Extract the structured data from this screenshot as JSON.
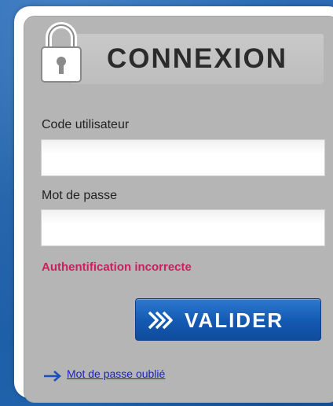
{
  "login": {
    "title": "CONNEXION",
    "username_label": "Code utilisateur",
    "username_value": "",
    "password_label": "Mot de passe",
    "password_value": "",
    "error_message": "Authentification incorrecte",
    "submit_label": "VALIDER",
    "forgot_password_label": "Mot de passe oublié"
  },
  "icons": {
    "lock": "lock-icon",
    "submit_chevrons": "double-chevron-right-icon",
    "forgot_arrow": "arrow-right-icon"
  },
  "colors": {
    "background": "#1c5ea8",
    "panel": "#b5b5b5",
    "error": "#cc1f5d",
    "button": "#1459b1",
    "link": "#1d23b8"
  }
}
